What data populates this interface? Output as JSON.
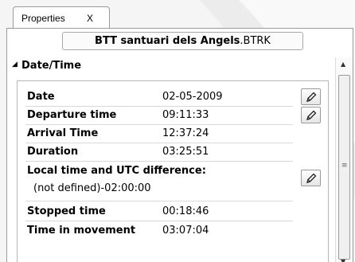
{
  "tab": {
    "label": "Properties",
    "close": "X"
  },
  "file": {
    "name": "BTT santuari dels Angels",
    "extension": ".BTRK"
  },
  "section": {
    "title": "Date/Time",
    "arrow": "◢"
  },
  "rows": {
    "date": {
      "label": "Date",
      "value": "02-05-2009"
    },
    "departure": {
      "label": "Departure time",
      "value": "09:11:33"
    },
    "arrival": {
      "label": "Arrival Time",
      "value": "12:37:24"
    },
    "duration": {
      "label": "Duration",
      "value": "03:25:51"
    },
    "utc": {
      "label": "Local time and UTC difference:",
      "value": "(not defined)-02:00:00"
    },
    "stopped": {
      "label": "Stopped time",
      "value": "00:18:46"
    },
    "movement": {
      "label": "Time in movement",
      "value": "03:07:04"
    }
  },
  "scrollbar": {
    "up": "▲",
    "down": "▼",
    "grip": "≡"
  },
  "icons": {
    "edit": "pencil-icon"
  },
  "colors": {
    "background": "#f5f5f5",
    "panel": "#ffffff",
    "border": "#9a9a9a"
  }
}
